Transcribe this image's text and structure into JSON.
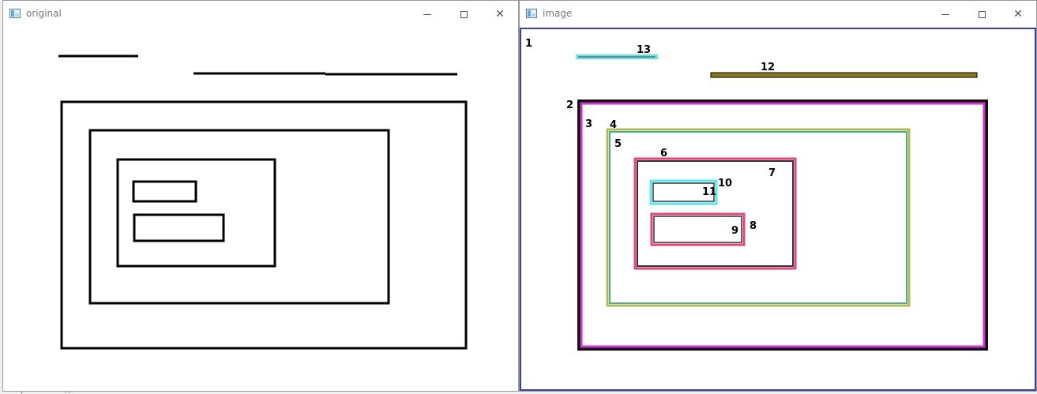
{
  "background_code": "plt.show()",
  "windows": {
    "original": {
      "title": "original",
      "buttons": {
        "minimize": "minimize",
        "maximize": "maximize",
        "close": "close"
      }
    },
    "image": {
      "title": "image",
      "buttons": {
        "minimize": "minimize",
        "maximize": "maximize",
        "close": "close"
      },
      "contour_labels": [
        "1",
        "2",
        "3",
        "4",
        "5",
        "6",
        "7",
        "8",
        "9",
        "10",
        "11",
        "12",
        "13"
      ]
    }
  },
  "icons": {
    "app": "window-app-icon",
    "minimize": "minimize-icon",
    "maximize": "maximize-icon",
    "close": "close-icon"
  },
  "colors": {
    "frame_blue": "#3b3fae",
    "contour_magenta": "#cc33cc",
    "contour_olive": "#b5b85a",
    "contour_green": "#4fae8a",
    "contour_pink": "#e0457a",
    "contour_cyan": "#55e8ee",
    "contour_brown": "#8a7a1e"
  }
}
